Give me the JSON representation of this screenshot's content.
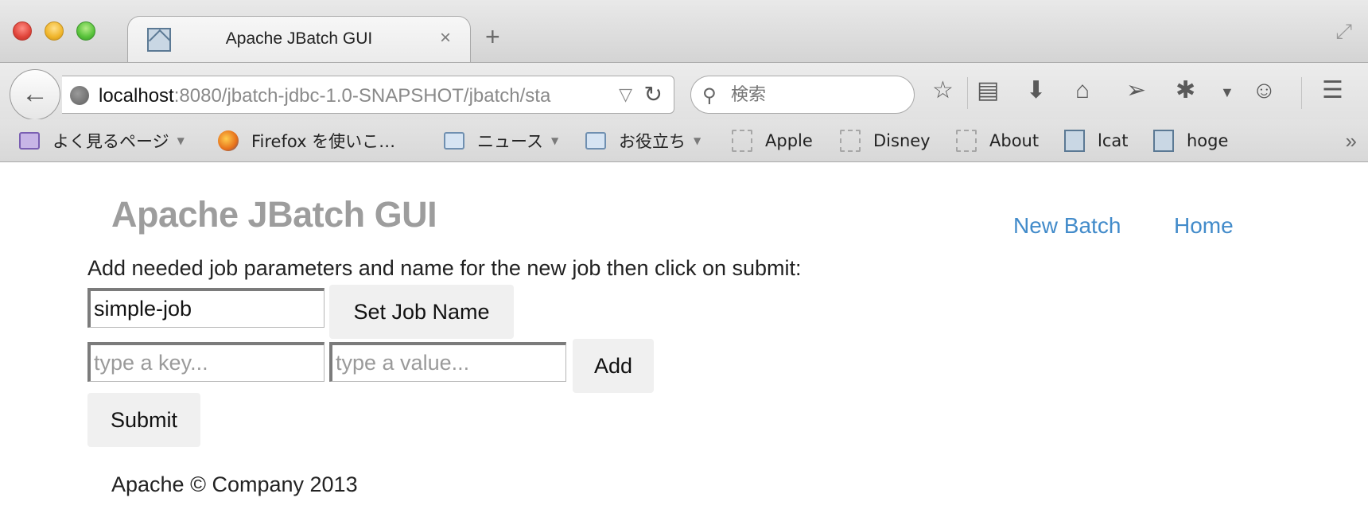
{
  "window": {
    "tab_title": "Apache JBatch GUI",
    "tab_close": "×",
    "new_tab": "+"
  },
  "navigation": {
    "url_host": "localhost",
    "url_rest": ":8080/jbatch-jdbc-1.0-SNAPSHOT/jbatch/sta",
    "search_placeholder": "検索"
  },
  "bookmarks": [
    {
      "label": "よく見るページ",
      "icon": "smart-folder-icon"
    },
    {
      "label": "Firefox を使いこ…",
      "icon": "firefox-icon"
    },
    {
      "label": "ニュース",
      "icon": "folder-icon"
    },
    {
      "label": "お役立ち",
      "icon": "folder-icon"
    },
    {
      "label": "Apple",
      "icon": "blank-page-icon"
    },
    {
      "label": "Disney",
      "icon": "blank-page-icon"
    },
    {
      "label": "About",
      "icon": "blank-page-icon"
    },
    {
      "label": "lcat",
      "icon": "page-icon"
    },
    {
      "label": "hoge",
      "icon": "page-icon"
    }
  ],
  "page": {
    "brand": "Apache JBatch GUI",
    "nav": {
      "new_batch": "New Batch",
      "home": "Home"
    },
    "instructions": "Add needed job parameters and name for the new job then click on submit:",
    "job_name_value": "simple-job",
    "set_job_name_label": "Set Job Name",
    "key_placeholder": "type a key...",
    "value_placeholder": "type a value...",
    "add_label": "Add",
    "submit_label": "Submit",
    "footer": "Apache © Company 2013"
  },
  "colors": {
    "link": "#428bca",
    "brand_text": "#9d9d9d",
    "button_bg": "#f0f0f0"
  }
}
